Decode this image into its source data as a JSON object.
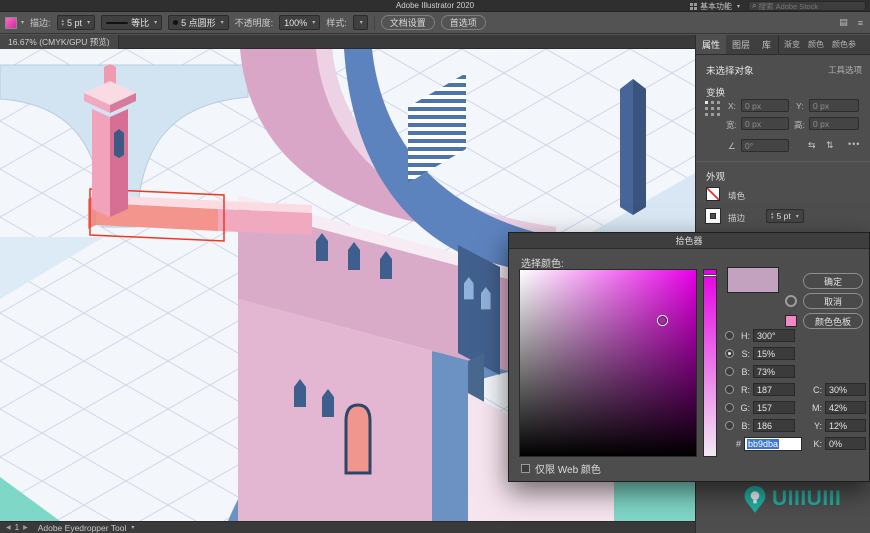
{
  "titlebar": {
    "title": "Adobe Illustrator 2020",
    "workspace_label": "基本功能",
    "search_placeholder": "搜索 Adobe Stock"
  },
  "controlbar": {
    "stroke_label": "描边:",
    "stroke_weight": "5 pt",
    "width_profile": "等比",
    "brush": "5 点圆形",
    "opacity_label": "不透明度:",
    "opacity_value": "100%",
    "style_label": "样式:",
    "document_setup": "文档设置",
    "preferences": "首选项"
  },
  "document_tab": {
    "label": "16.67% (CMYK/GPU 预览)"
  },
  "panel": {
    "tabs_group1": [
      "属性",
      "图层",
      "库"
    ],
    "tabs_group2": [
      "渐变",
      "颜色",
      "颜色参"
    ],
    "no_selection": "未选择对象",
    "tool_options": "工具选项",
    "transform": {
      "title": "变换",
      "x_label": "X:",
      "x_value": "0 px",
      "y_label": "Y:",
      "y_value": "0 px",
      "w_label": "宽:",
      "w_value": "0 px",
      "h_label": "高:",
      "h_value": "0 px",
      "rotate_value": "0°"
    },
    "appearance": {
      "title": "外观",
      "fill_label": "填色",
      "stroke_label": "描边",
      "stroke_value": "5 pt"
    }
  },
  "color_picker": {
    "title": "拾色器",
    "prompt": "选择颜色:",
    "ok": "确定",
    "cancel": "取消",
    "swatches": "颜色色板",
    "new_color": "#c2a2bf",
    "hsb": {
      "h_label": "H:",
      "h_value": "300°",
      "s_label": "S:",
      "s_value": "15%",
      "b_label": "B:",
      "b_value": "73%"
    },
    "rgb": {
      "r_label": "R:",
      "r_value": "187",
      "g_label": "G:",
      "g_value": "157",
      "b_label": "B:",
      "b_value": "186"
    },
    "cmyk": {
      "c_label": "C:",
      "c_value": "30%",
      "m_label": "M:",
      "m_value": "42%",
      "y_label": "Y:",
      "y_value": "12%",
      "k_label": "K:",
      "k_value": "0%"
    },
    "hex_label": "#",
    "hex_value": "bb9dba",
    "web_only": "仅限 Web 颜色"
  },
  "statusbar": {
    "artboard_number": "1",
    "tool_name": "Adobe Eyedropper Tool"
  },
  "watermark": {
    "text": "UIIIUIII"
  },
  "palette": {
    "canvas_bg": "#f3f6fb",
    "grid": "#c9d0e6",
    "pink_road": "#d9a6c8",
    "tower_rose": "#d76f94",
    "salmon": "#f4958d",
    "blue_road": "#5d83be",
    "navy": "#42608e",
    "teal": "#7fd7c7",
    "selection_red": "#ee3822",
    "picked_hex": "#bb9dba"
  }
}
